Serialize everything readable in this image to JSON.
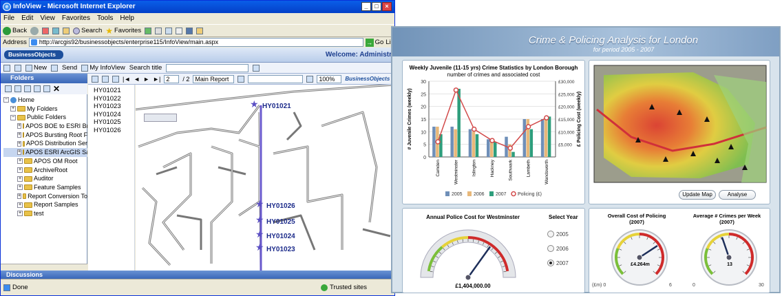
{
  "ie": {
    "title": "InfoView - Microsoft Internet Explorer",
    "menu": [
      "File",
      "Edit",
      "View",
      "Favorites",
      "Tools",
      "Help"
    ],
    "toolbar": {
      "back": "Back",
      "search": "Search",
      "favorites": "Favorites"
    },
    "address_label": "Address",
    "address": "http://arcgis92/businessobjects/enterprise115/InfoView/main.aspx",
    "go": "Go",
    "links": "Lin",
    "status": "Done",
    "zone": "Trusted sites"
  },
  "bo": {
    "logo": "BusinessObjects",
    "welcome": "Welcome: Administr",
    "toolbar": {
      "new": "New",
      "send": "Send",
      "myinfoview": "My InfoView",
      "search_title": "Search title"
    },
    "folders_header": "Folders",
    "tree": [
      {
        "label": "Home",
        "level": 0
      },
      {
        "label": "My Folders",
        "level": 1
      },
      {
        "label": "Public Folders",
        "level": 1
      },
      {
        "label": "APOS BOE to ESRI Br",
        "level": 2
      },
      {
        "label": "APOS Bursting Root F",
        "level": 2
      },
      {
        "label": "APOS Distribution Ser",
        "level": 2
      },
      {
        "label": "APOS ESRI ArcGIS Sa",
        "level": 2
      },
      {
        "label": "APOS OM Root",
        "level": 2
      },
      {
        "label": "ArchiveRoot",
        "level": 2
      },
      {
        "label": "Auditor",
        "level": 2
      },
      {
        "label": "Feature Samples",
        "level": 2
      },
      {
        "label": "Report Conversion To",
        "level": 2
      },
      {
        "label": "Report Samples",
        "level": 2
      },
      {
        "label": "test",
        "level": 2
      }
    ],
    "discussions": "Discussions"
  },
  "report": {
    "page": "2",
    "of_pages": "/ 2",
    "view": "Main Report",
    "zoom": "100%",
    "logo": "BusinessObjects",
    "list": [
      "HY01021",
      "HY01022",
      "HY01023",
      "HY01024",
      "HY01025",
      "HY01026"
    ],
    "map_labels": [
      "HY01021",
      "HY01026",
      "HY01025",
      "HY01024",
      "HY01023"
    ]
  },
  "dashboard": {
    "title": "Crime & Policing Analysis for London",
    "subtitle": "for period 2005 - 2007",
    "map_buttons": {
      "update": "Update Map",
      "analyse": "Analyse"
    },
    "police_title": "Annual Police Cost for Westminster",
    "police_value": "£1,404,000.00",
    "select_year": "Select Year",
    "years": [
      "2005",
      "2006",
      "2007"
    ],
    "selected_year": "2007",
    "gauge_cost": {
      "title": "Overall Cost of Policing",
      "year": "(2007)",
      "value": "£4.264m",
      "unit": "(£m) 0",
      "max": "6",
      "fraction": 0.71
    },
    "gauge_crimes": {
      "title": "Average # Crimes per Week",
      "year": "(2007)",
      "value": "13",
      "min": "0",
      "max": "30",
      "fraction": 0.43
    },
    "police_gauge_fraction": 0.72
  },
  "chart_data": {
    "type": "bar",
    "title": "Weekly Juvenile (11-15 yrs) Crime Statistics by London Borough",
    "subtitle": "number of crimes and associated cost",
    "ylabel": "# Juvenile Crimes (weekly)",
    "y2label": "£ Policing Cost (weekly)",
    "ylim": [
      0,
      30
    ],
    "y2lim": [
      0,
      30000
    ],
    "yticks": [
      "0",
      "5",
      "10",
      "15",
      "20",
      "25",
      "30"
    ],
    "y2ticks": [
      "£5,000",
      "£10,000",
      "£15,000",
      "£20,000",
      "£25,000",
      "£30,000"
    ],
    "categories": [
      "Camden",
      "Westminster",
      "Islington",
      "Hackney",
      "Southwark",
      "Lambeth",
      "Wandsworth"
    ],
    "series": [
      {
        "name": "2005",
        "values": [
          12,
          12,
          11,
          7,
          8,
          15,
          15
        ]
      },
      {
        "name": "2006",
        "values": [
          12,
          11,
          10,
          6,
          5,
          15,
          16
        ]
      },
      {
        "name": "2007",
        "values": [
          9,
          27,
          9,
          6,
          2,
          11,
          16
        ]
      },
      {
        "name": "Policing (£)",
        "values": [
          6000,
          26500,
          11000,
          6500,
          3500,
          12000,
          15500
        ]
      }
    ],
    "colors": [
      "#6f8fb8",
      "#e8b87a",
      "#2e9e7c",
      "#d24a4a"
    ]
  }
}
